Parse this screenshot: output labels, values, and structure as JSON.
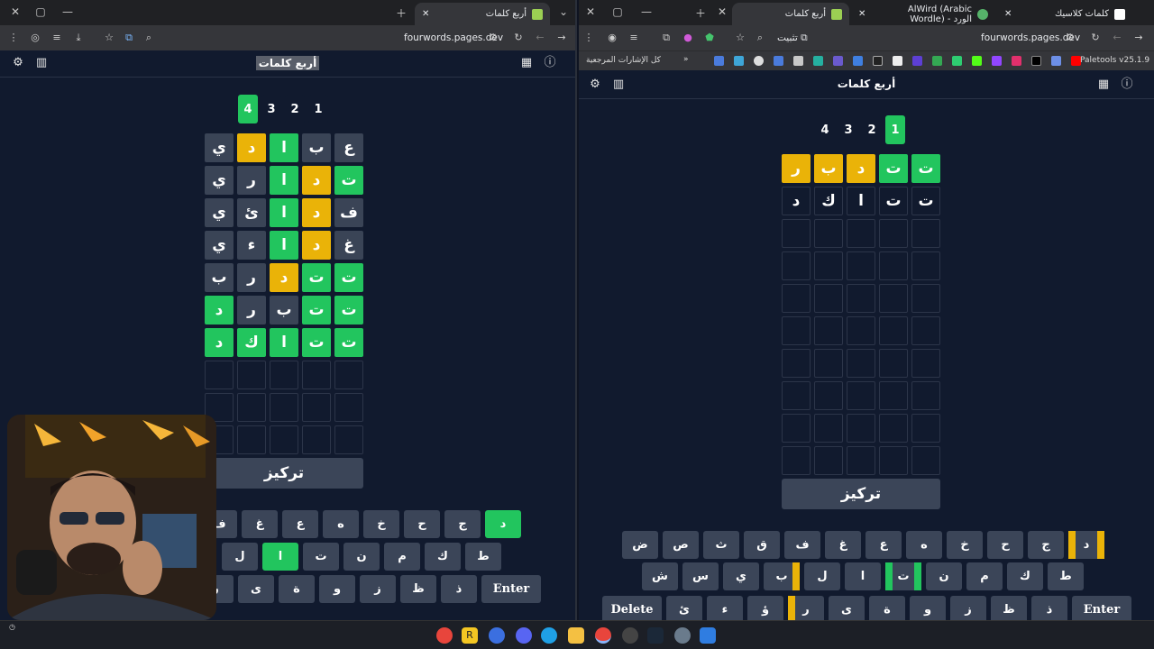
{
  "left": {
    "tabs": [
      {
        "title": "أربع كلمات"
      }
    ],
    "url": "fourwords.pages.dev",
    "app_title": "أربع كلمات",
    "boards": [
      "1",
      "2",
      "3",
      "4"
    ],
    "active_board": "4",
    "grid": [
      [
        "ع",
        "ب",
        "ا",
        "د",
        "ي"
      ],
      [
        "ت",
        "د",
        "ا",
        "ر",
        "ي"
      ],
      [
        "ف",
        "د",
        "ا",
        "ئ",
        "ي"
      ],
      [
        "غ",
        "د",
        "ا",
        "ء",
        "ي"
      ],
      [
        "ت",
        "ت",
        "د",
        "ر",
        "ب"
      ],
      [
        "ت",
        "ت",
        "ب",
        "ر",
        "د"
      ],
      [
        "ت",
        "ت",
        "ا",
        "ك",
        "د"
      ]
    ],
    "focus_label": "تركيز",
    "keys_row1": [
      "د",
      "ج",
      "ح",
      "خ",
      "ه",
      "ع",
      "غ",
      "ف"
    ],
    "keys_row2": [
      "ط",
      "ك",
      "م",
      "ن",
      "ت",
      "ا",
      "ل"
    ],
    "keys_row3": [
      "Enter",
      "ذ",
      "ظ",
      "ز",
      "و",
      "ة",
      "ى",
      "ر"
    ]
  },
  "right": {
    "tabs": [
      {
        "title": "كلمات كلاسيك"
      },
      {
        "title": "AlWird (Arabic Wordle) - الورد"
      },
      {
        "title": "أربع كلمات"
      }
    ],
    "url": "fourwords.pages.dev",
    "install_label": "تثبيت",
    "bookmarks_all": "كل الإشارات المرجعية",
    "bookmark_paletools": "Paletools v25.1.9",
    "app_title": "أربع كلمات",
    "boards": [
      "1",
      "2",
      "3",
      "4"
    ],
    "active_board": "1",
    "grid": [
      [
        "ت",
        "ت",
        "د",
        "ب",
        "ر"
      ],
      [
        "ت",
        "ت",
        "ا",
        "ك",
        "د"
      ]
    ],
    "focus_label": "تركيز",
    "keys_row1": [
      "د",
      "ج",
      "ح",
      "خ",
      "ه",
      "ع",
      "غ",
      "ف",
      "ق",
      "ث",
      "ص",
      "ض"
    ],
    "keys_row2": [
      "ط",
      "ك",
      "م",
      "ن",
      "ت",
      "ا",
      "ل",
      "ب",
      "ي",
      "س",
      "ش"
    ],
    "keys_row3": [
      "Enter",
      "ذ",
      "ظ",
      "ز",
      "و",
      "ة",
      "ى",
      "ر",
      "ؤ",
      "ء",
      "ئ",
      "Delete"
    ]
  },
  "colors": {
    "green": "#22c55e",
    "yellow": "#eab308",
    "tile": "#3a4456",
    "bg": "#111a2e"
  }
}
